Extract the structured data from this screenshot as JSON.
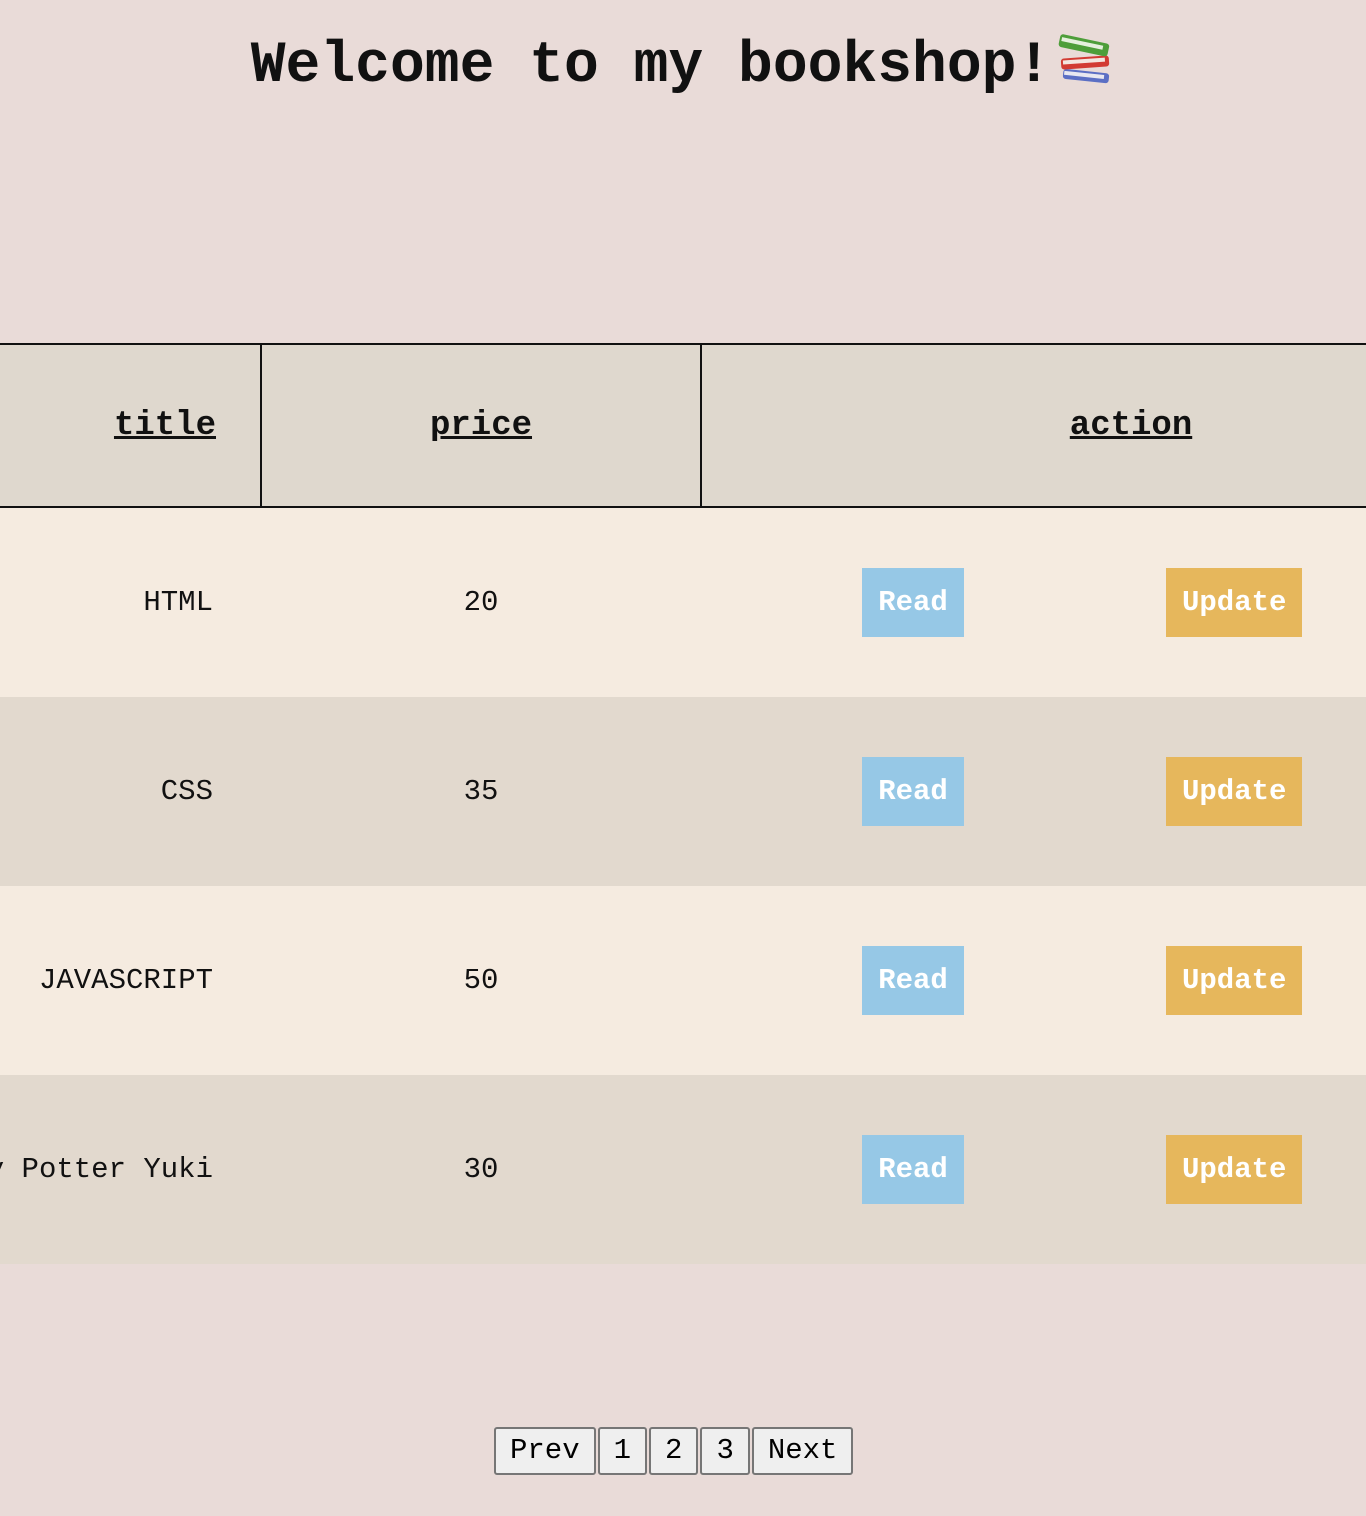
{
  "header": {
    "title": "Welcome to my bookshop!",
    "icon": "books-icon"
  },
  "table": {
    "columns": {
      "title": "title",
      "price": "price",
      "action": "action"
    },
    "rows": [
      {
        "title": "HTML",
        "price": "20",
        "read_label": "Read",
        "update_label": "Update"
      },
      {
        "title": "CSS",
        "price": "35",
        "read_label": "Read",
        "update_label": "Update"
      },
      {
        "title": "JAVASCRIPT",
        "price": "50",
        "read_label": "Read",
        "update_label": "Update"
      },
      {
        "title": "Harry Potter Yuki",
        "price": "30",
        "read_label": "Read",
        "update_label": "Update"
      }
    ]
  },
  "pagination": {
    "prev": "Prev",
    "pages": [
      "1",
      "2",
      "3"
    ],
    "next": "Next"
  },
  "colors": {
    "background": "#e9dbd8",
    "read_button": "#96c8e6",
    "update_button": "#e6b75c"
  }
}
